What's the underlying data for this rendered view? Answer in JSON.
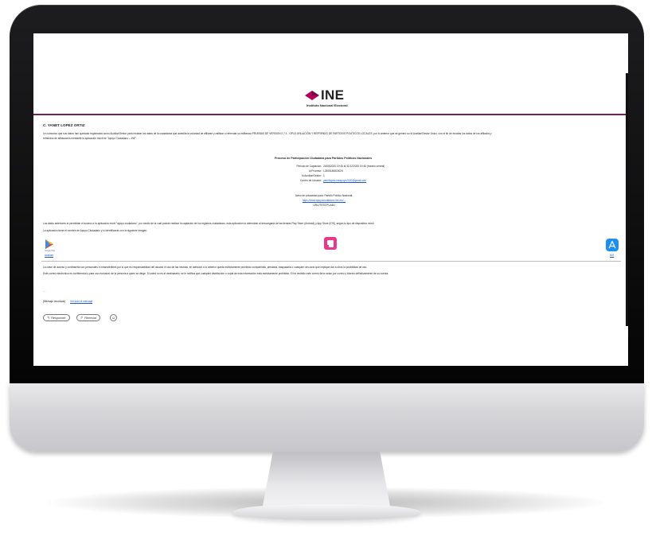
{
  "email": {
    "logo_word": "INE",
    "logo_subtitle": "Instituto Nacional Electoral",
    "recipient": "C. YANET LOPEZ ORTIZ",
    "intro_line1": "Le comunico que sus datos han quedado registrados como Auxiliar/Gestor para recabar los datos de la ciudadanía que acredita la voluntad de afiliarse y ratificar o refrendar su militancia PRUEBAS DE VERSION 2.7.1 - OPLE AFILIACIÓN Y REFRENDO DE PARTIDOS POLÍTICOS LOCALES, por lo anterior que se generó su Id Auxiliar/Gestor Único, con el fin de recabar los datos de los afiliados y",
    "intro_line2": "refrendos de afiliaciones mediante la aplicación móvil de \"Apoyo Ciudadano – INE\".",
    "process_title": "Proceso de Participación Ciudadana para Partidos Políticos Nacionales",
    "fields": [
      {
        "label": "Periodo de Captación:",
        "value": "24/08/2020 19:45 al 31/12/2020 19:45 (horario central)"
      },
      {
        "label": "Id Proceso:",
        "value": "L2505180820024"
      },
      {
        "label": "Id Auxiliar/Gestor:",
        "value": "1"
      },
      {
        "label": "Correo de Usuario:",
        "value": "yanetlopez.ineapoyo2020@gmail.com"
      }
    ],
    "privacy_label": "Aviso de privacidad para: Partido Político Nacional:",
    "privacy_link": "https://www.apoyociudadano.ine.mx/...",
    "privacy_code": "URL//TEST/PLAIN/",
    "apps_line": "Los datos anteriores le permitirán el acceso a la aplicación móvil \"apoyo ciudadano\", por medio de la cual podrán realizar la captación de los registros ciudadanos, esta aplicación la obtendrán al descargarla de las tiendas Play Store (Android) y App Store (iOS), según tu tipo de dispositivo móvil.",
    "app_name_line": "La aplicación tiene el nombre de Apoyo Ciudadano y lo identificarás con la siguiente imagen:",
    "android_link": "Android",
    "ios_link": "iOS",
    "google_play_caption": "Google Play",
    "notice1": "La clave de acceso y contraseña son personales e intransferibles por lo que es responsabilidad del usuario el uso de las mismas, en atención a lo anterior queda estrictamente prohibido compartirlas, prestarla, traspasarla o cualquier otro acto que implique dar a otros la posibilidad de uso.",
    "notice2": "Este correo electrónico es confidencial y para uso exclusivo de la persona a quien se dirige. Si usted no es el destinatario, se le notifica que cualquier distribución o copia de esta información está estrictamente prohibida. Si ha recibido este correo favor avise por correo y bórrelo definitivamente de su cuenta.",
    "dots": "...",
    "trimmed_label": "[Mensaje recortado]",
    "trimmed_link": "Ver todo el mensaje",
    "reply_label": "Responder",
    "forward_label": "Reenviar",
    "emoji_glyph": "☺"
  }
}
